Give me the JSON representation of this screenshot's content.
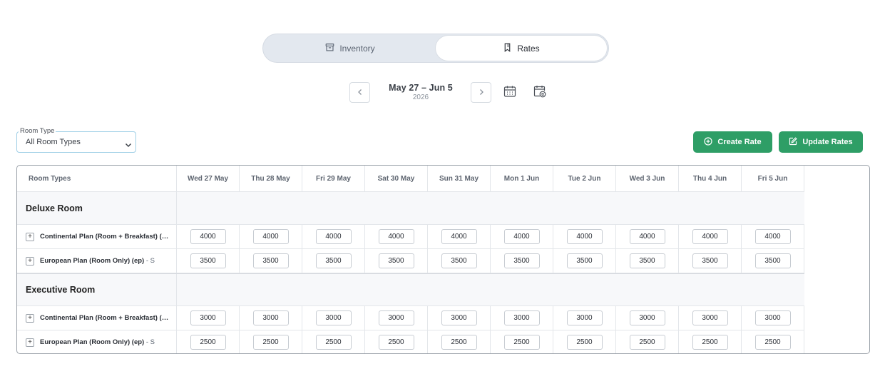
{
  "tabs": {
    "inventory_label": "Inventory",
    "rates_label": "Rates"
  },
  "date_nav": {
    "range": "May 27 – Jun 5",
    "year": "2026"
  },
  "filter": {
    "legend": "Room Type",
    "value": "All Room Types"
  },
  "actions": {
    "create_label": "Create Rate",
    "update_label": "Update Rates"
  },
  "table": {
    "first_header": "Room Types",
    "days": [
      "Wed 27 May",
      "Thu 28 May",
      "Fri 29 May",
      "Sat 30 May",
      "Sun 31 May",
      "Mon 1 Jun",
      "Tue 2 Jun",
      "Wed 3 Jun",
      "Thu 4 Jun",
      "Fri 5 Jun"
    ],
    "groups": [
      {
        "name": "Deluxe Room",
        "plans": [
          {
            "label": "Continental Plan (Room + Breakfast) (cp) - S",
            "suffix": "",
            "rates": [
              "4000",
              "4000",
              "4000",
              "4000",
              "4000",
              "4000",
              "4000",
              "4000",
              "4000",
              "4000"
            ]
          },
          {
            "label": "European Plan (Room Only) (ep)",
            "suffix": " - S",
            "rates": [
              "3500",
              "3500",
              "3500",
              "3500",
              "3500",
              "3500",
              "3500",
              "3500",
              "3500",
              "3500"
            ]
          }
        ]
      },
      {
        "name": "Executive Room",
        "plans": [
          {
            "label": "Continental Plan (Room + Breakfast) (cp) - S",
            "suffix": "",
            "rates": [
              "3000",
              "3000",
              "3000",
              "3000",
              "3000",
              "3000",
              "3000",
              "3000",
              "3000",
              "3000"
            ]
          },
          {
            "label": "European Plan (Room Only) (ep)",
            "suffix": " - S",
            "rates": [
              "2500",
              "2500",
              "2500",
              "2500",
              "2500",
              "2500",
              "2500",
              "2500",
              "2500",
              "2500"
            ]
          }
        ]
      }
    ]
  },
  "colors": {
    "accent_green": "#2e9e66",
    "toggle_bg": "#e3e8ef"
  }
}
